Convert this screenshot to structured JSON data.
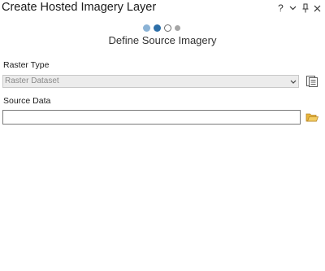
{
  "window": {
    "title": "Create Hosted Imagery Layer",
    "controls": {
      "help": "?",
      "options": "⌄",
      "pin": "⊥",
      "close": "✕"
    }
  },
  "wizard": {
    "steps": [
      {
        "state": "done"
      },
      {
        "state": "current"
      },
      {
        "state": "next"
      },
      {
        "state": "future"
      }
    ],
    "step_title": "Define Source Imagery"
  },
  "raster_type": {
    "label": "Raster Type",
    "value": "Raster Dataset",
    "chevron": "⌄"
  },
  "source_data": {
    "label": "Source Data",
    "value": ""
  },
  "icons": {
    "properties": "properties-icon",
    "browse": "folder-icon"
  },
  "colors": {
    "accent": "#2d6fa8",
    "folder": "#e8b63b"
  }
}
